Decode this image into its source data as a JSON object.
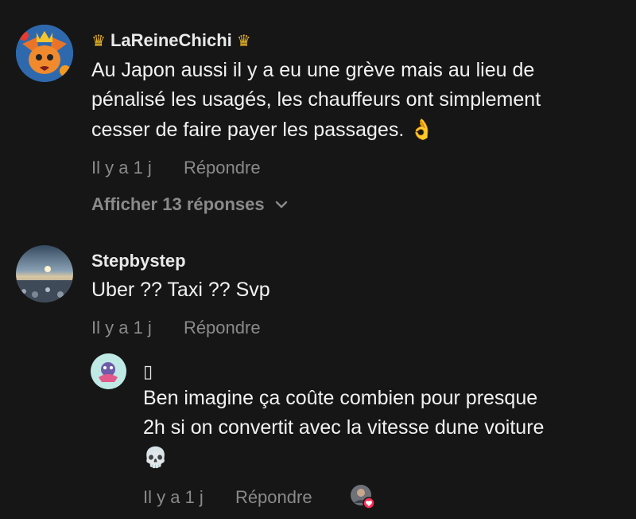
{
  "comments": [
    {
      "username": "LaReineChichi",
      "crown_icon": "crown-icon",
      "text_lines": [
        "Au Japon aussi il y a eu une grève mais au lieu de",
        "pénalisé les usagés, les chauffeurs ont simplement",
        "cesser de faire payer les passages."
      ],
      "emoji": "👌",
      "time": "Il y a 1 j",
      "reply_label": "Répondre",
      "show_replies": "Afficher 13 réponses"
    },
    {
      "username": "Stepbystep",
      "text_lines": [
        "Uber ?? Taxi ?? Svp"
      ],
      "time": "Il y a 1 j",
      "reply_label": "Répondre"
    },
    {
      "username": "▯",
      "text_lines": [
        "Ben imagine ça coûte combien pour presque",
        "2h si on convertit avec la vitesse dune voiture"
      ],
      "emoji": "💀",
      "time": "Il y a 1 j",
      "reply_label": "Répondre",
      "liked_by_creator": true
    }
  ],
  "colors": {
    "background": "#161616",
    "meta_text": "#8a8a8a",
    "like_badge": "#fe2c55"
  }
}
